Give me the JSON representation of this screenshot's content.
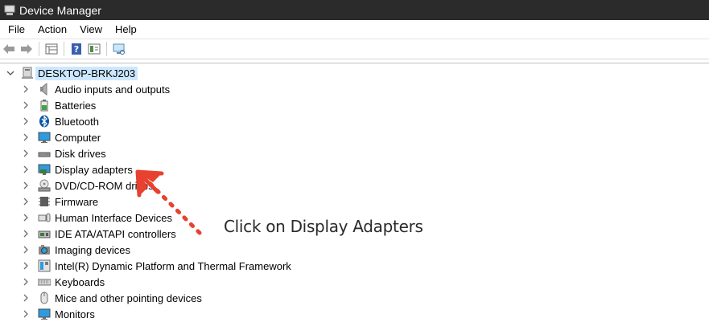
{
  "window": {
    "title": "Device Manager",
    "icon": "device-manager-icon"
  },
  "menu": [
    "File",
    "Action",
    "View",
    "Help"
  ],
  "toolbar": [
    "back-icon",
    "forward-icon",
    "properties-grid-icon",
    "help-icon",
    "update-driver-icon",
    "scan-hardware-icon"
  ],
  "tree": {
    "root": {
      "label": "DESKTOP-BRKJ203",
      "icon": "computer-icon",
      "expanded": true
    },
    "items": [
      {
        "label": "Audio inputs and outputs",
        "icon": "speaker-icon"
      },
      {
        "label": "Batteries",
        "icon": "battery-icon"
      },
      {
        "label": "Bluetooth",
        "icon": "bluetooth-icon"
      },
      {
        "label": "Computer",
        "icon": "monitor-icon"
      },
      {
        "label": "Disk drives",
        "icon": "disk-drive-icon"
      },
      {
        "label": "Display adapters",
        "icon": "display-adapter-icon"
      },
      {
        "label": "DVD/CD-ROM drives",
        "icon": "dvd-icon"
      },
      {
        "label": "Firmware",
        "icon": "firmware-icon"
      },
      {
        "label": "Human Interface Devices",
        "icon": "hid-icon"
      },
      {
        "label": "IDE ATA/ATAPI controllers",
        "icon": "ide-controller-icon"
      },
      {
        "label": "Imaging devices",
        "icon": "camera-icon"
      },
      {
        "label": "Intel(R) Dynamic Platform and Thermal Framework",
        "icon": "chip-icon"
      },
      {
        "label": "Keyboards",
        "icon": "keyboard-icon"
      },
      {
        "label": "Mice and other pointing devices",
        "icon": "mouse-icon"
      },
      {
        "label": "Monitors",
        "icon": "monitor-icon"
      }
    ]
  },
  "annotation": {
    "text": "Click on Display Adapters",
    "color": "#e8412f"
  },
  "colors": {
    "titlebar": "#2b2b2b",
    "selection": "#cce8ff"
  }
}
